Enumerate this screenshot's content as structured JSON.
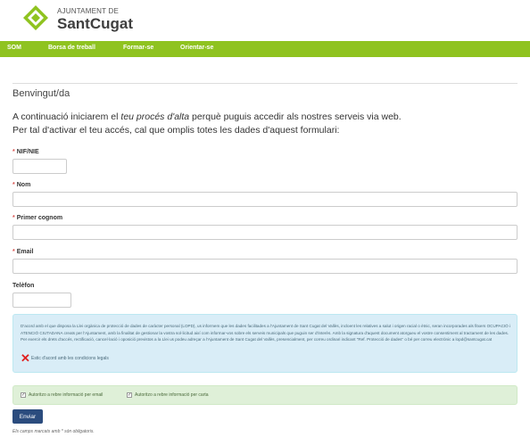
{
  "header": {
    "logo_small": "AJUNTAMENT DE",
    "logo_big": "SantCugat",
    "brand_color": "#8fc320"
  },
  "nav": {
    "items": [
      "SOM",
      "Borsa de treball",
      "Formar-se",
      "Orientar-se"
    ]
  },
  "form": {
    "welcome": "Benvingut/da",
    "intro_line1_a": "A continuació iniciarem el ",
    "intro_line1_em": "teu procés d'alta",
    "intro_line1_b": " perquè puguis accedir als nostres serveis via web.",
    "intro_line2": "Per tal d'activar el teu accés, cal que omplis totes les dades d'aquest formulari:",
    "required_marker": "*",
    "fields": {
      "nif": {
        "label": "NIF/NIE",
        "value": ""
      },
      "nom": {
        "label": "Nom",
        "value": ""
      },
      "cognom": {
        "label": "Primer cognom",
        "value": ""
      },
      "email": {
        "label": "Email",
        "value": ""
      },
      "telefon": {
        "label": "Telèfon",
        "value": ""
      }
    }
  },
  "legal": {
    "text": "D'acord amb el que disposa la Llei orgànica de protecció de dades de caràcter personal (LOPD), us informem que les dades facilitades a l'Ajuntament de Sant Cugat del Vallès, incloent les relatives a salut i origen racial o ètnic, seran incorporades als fitxers OCUPACIÓ i ATENCIÓ CIUTADANA creats per l'Ajuntament, amb la finalitat de gestionar la vostra sol·licitud així com informar-vos sobre els serveis municipals que puguin ser d'interès. Amb la signatura d'aquest document atorgueu el vostre consentiment al tractament de les dades. Per exercir els drets d'accés, rectificació, cancel·lació i oposició previstos a la Llei us podeu adreçar a l'Ajuntament de Sant Cugat del Vallès, presencialment, per correu ordinari indicant \"Ref. Protecció de dades\" o bé per correu electrònic a lopd@santcugat.cat",
    "accept_label": "Estic d'acord amb les condicions legals"
  },
  "consent": {
    "email_label": "Autoritzo a rebre informació per email",
    "post_label": "Autoritzo a rebre informació per carta",
    "email_checked": true,
    "post_checked": true
  },
  "submit_label": "Enviar",
  "footnote": "Els camps marcats amb * són obligatoris."
}
